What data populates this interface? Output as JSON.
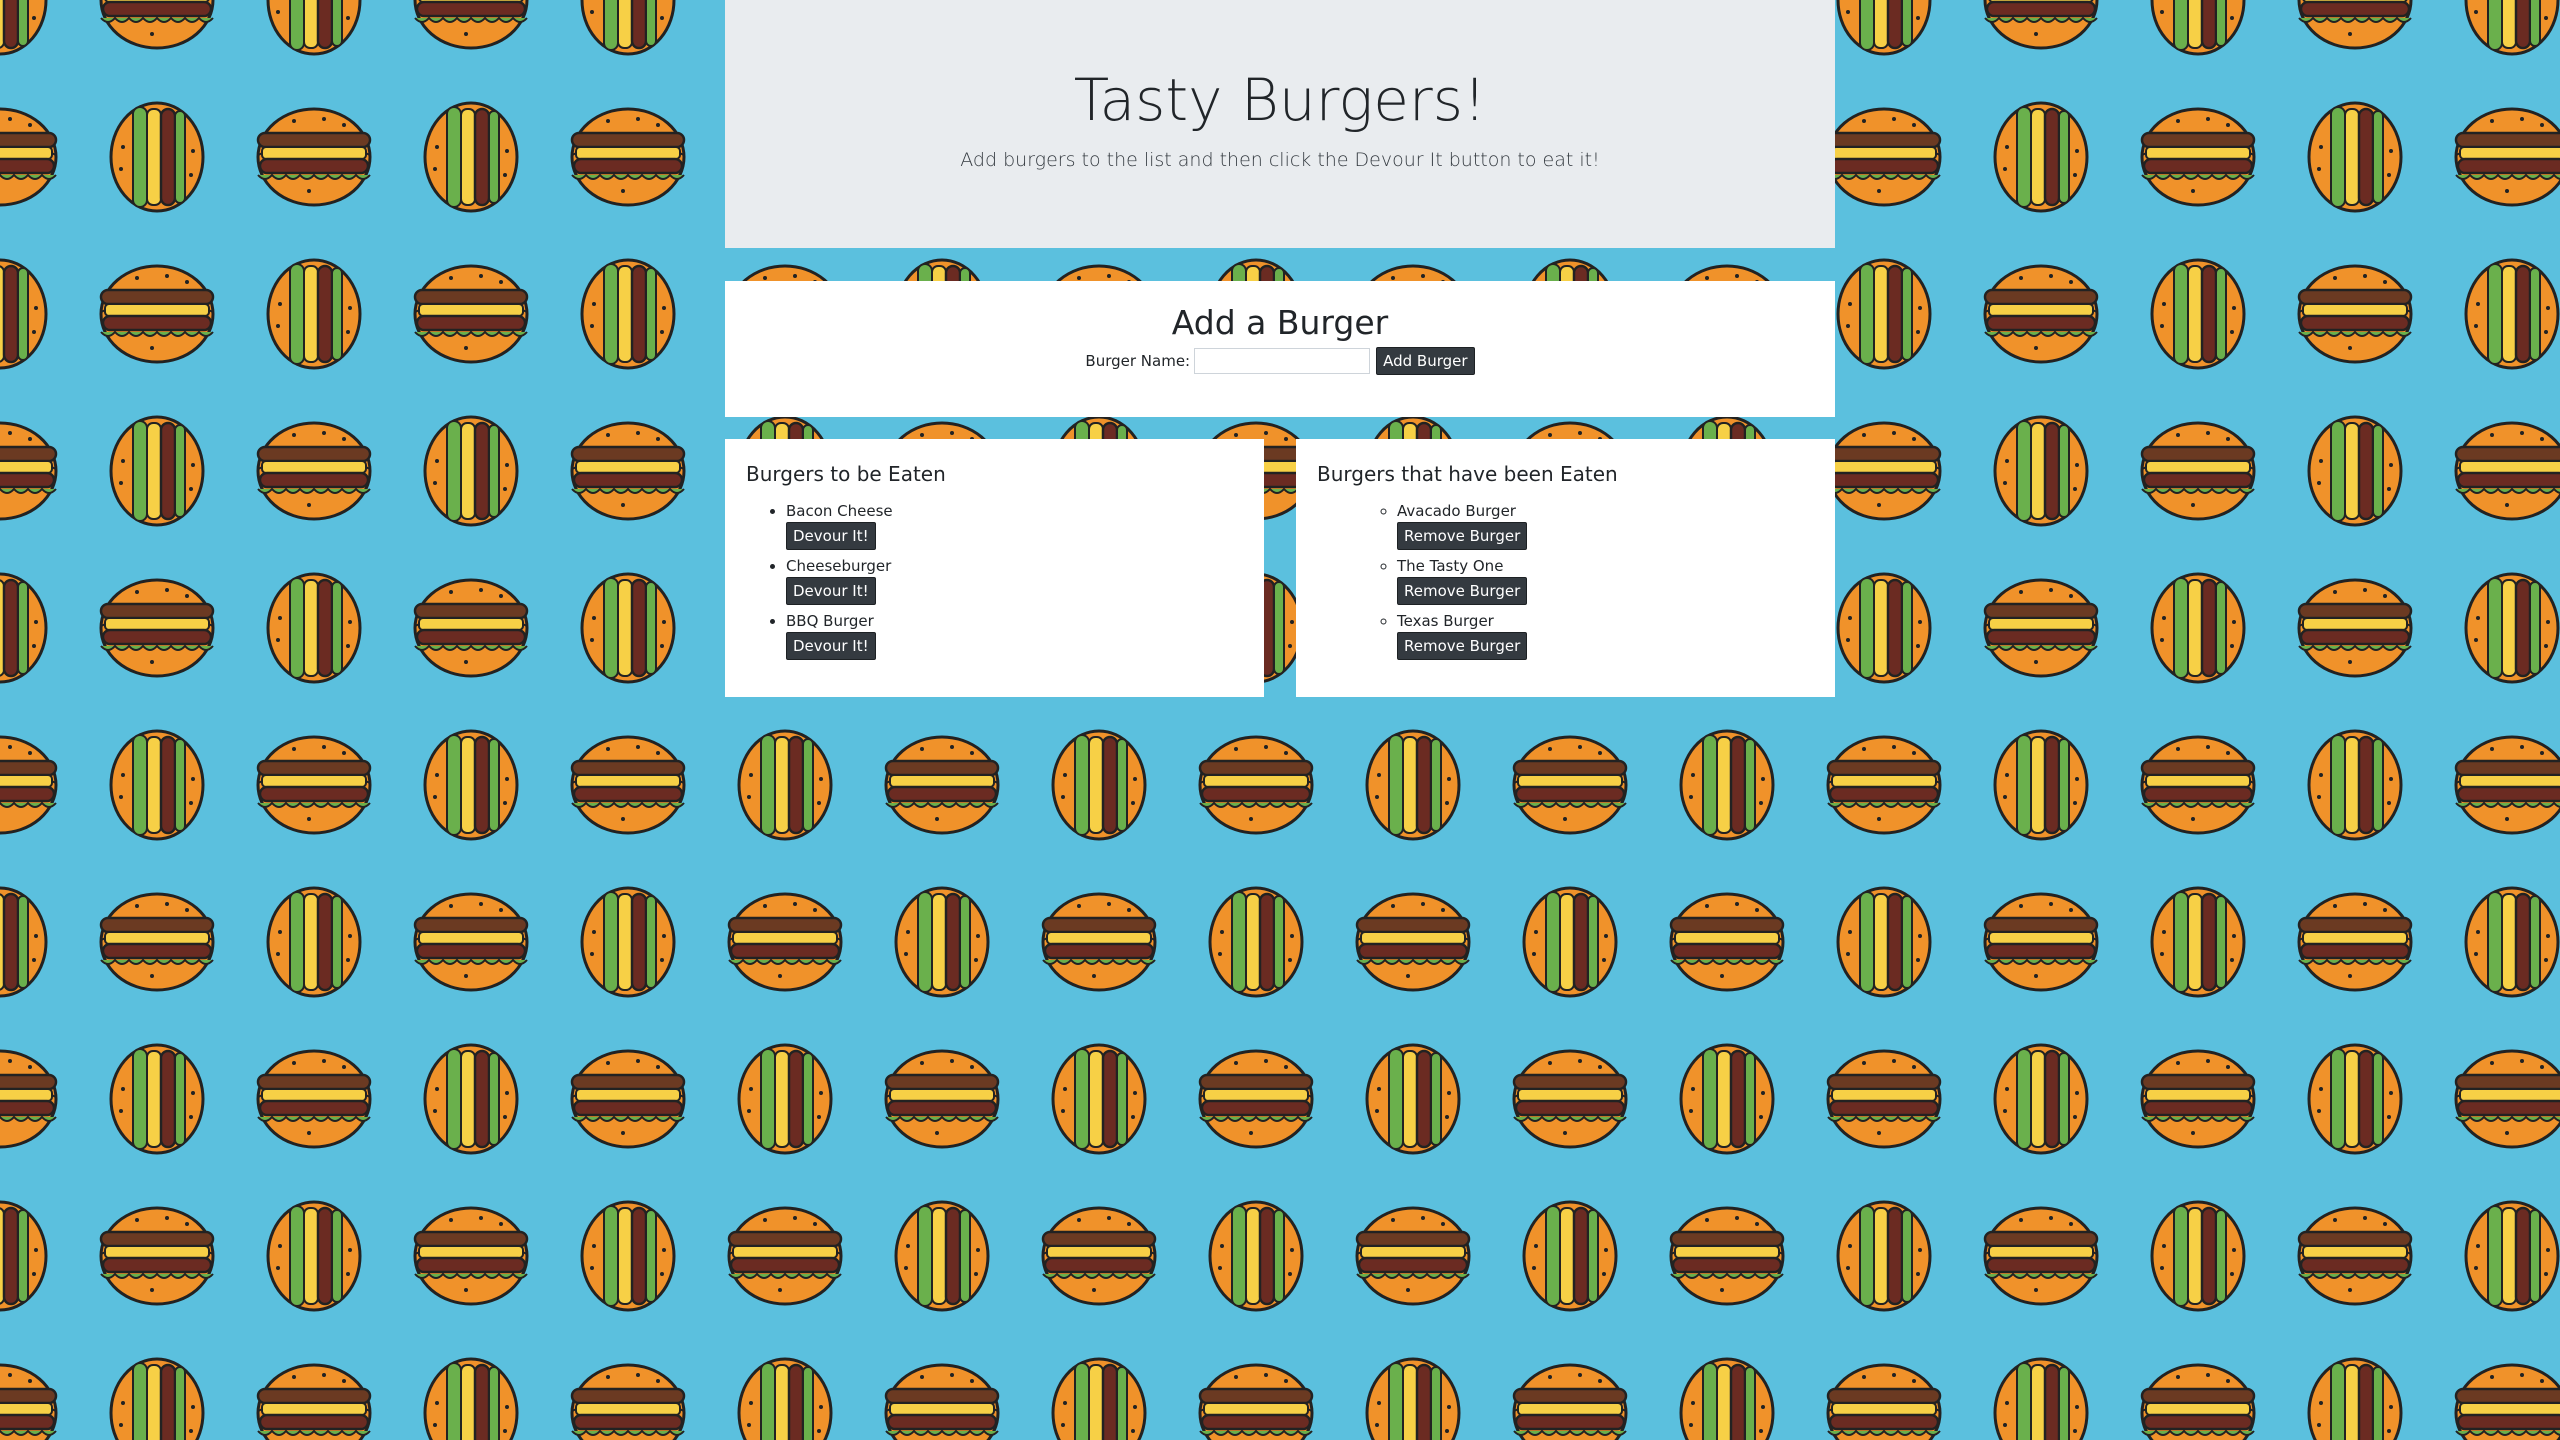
{
  "colors": {
    "background": "#5bc0de",
    "jumbotron": "#e9ecef",
    "button": "#343a40",
    "bun": "#f0922a",
    "patty": "#6b2b22",
    "lettuce": "#6ab04c",
    "cheese": "#f7d046"
  },
  "header": {
    "title": "Tasty Burgers!",
    "subtitle": "Add burgers to the list and then click the Devour It button to eat it!"
  },
  "add_form": {
    "heading": "Add a Burger",
    "label": "Burger Name:",
    "input_value": "",
    "button_label": "Add Burger"
  },
  "to_eat": {
    "heading": "Burgers to be Eaten",
    "button_label": "Devour It!",
    "items": [
      {
        "name": "Bacon Cheese"
      },
      {
        "name": "Cheeseburger"
      },
      {
        "name": "BBQ Burger"
      }
    ]
  },
  "eaten": {
    "heading": "Burgers that have been Eaten",
    "button_label": "Remove Burger",
    "items": [
      {
        "name": "Avacado Burger"
      },
      {
        "name": "The Tasty One"
      },
      {
        "name": "Texas Burger"
      }
    ]
  },
  "background": {
    "pattern_icon": "burger-icon"
  }
}
